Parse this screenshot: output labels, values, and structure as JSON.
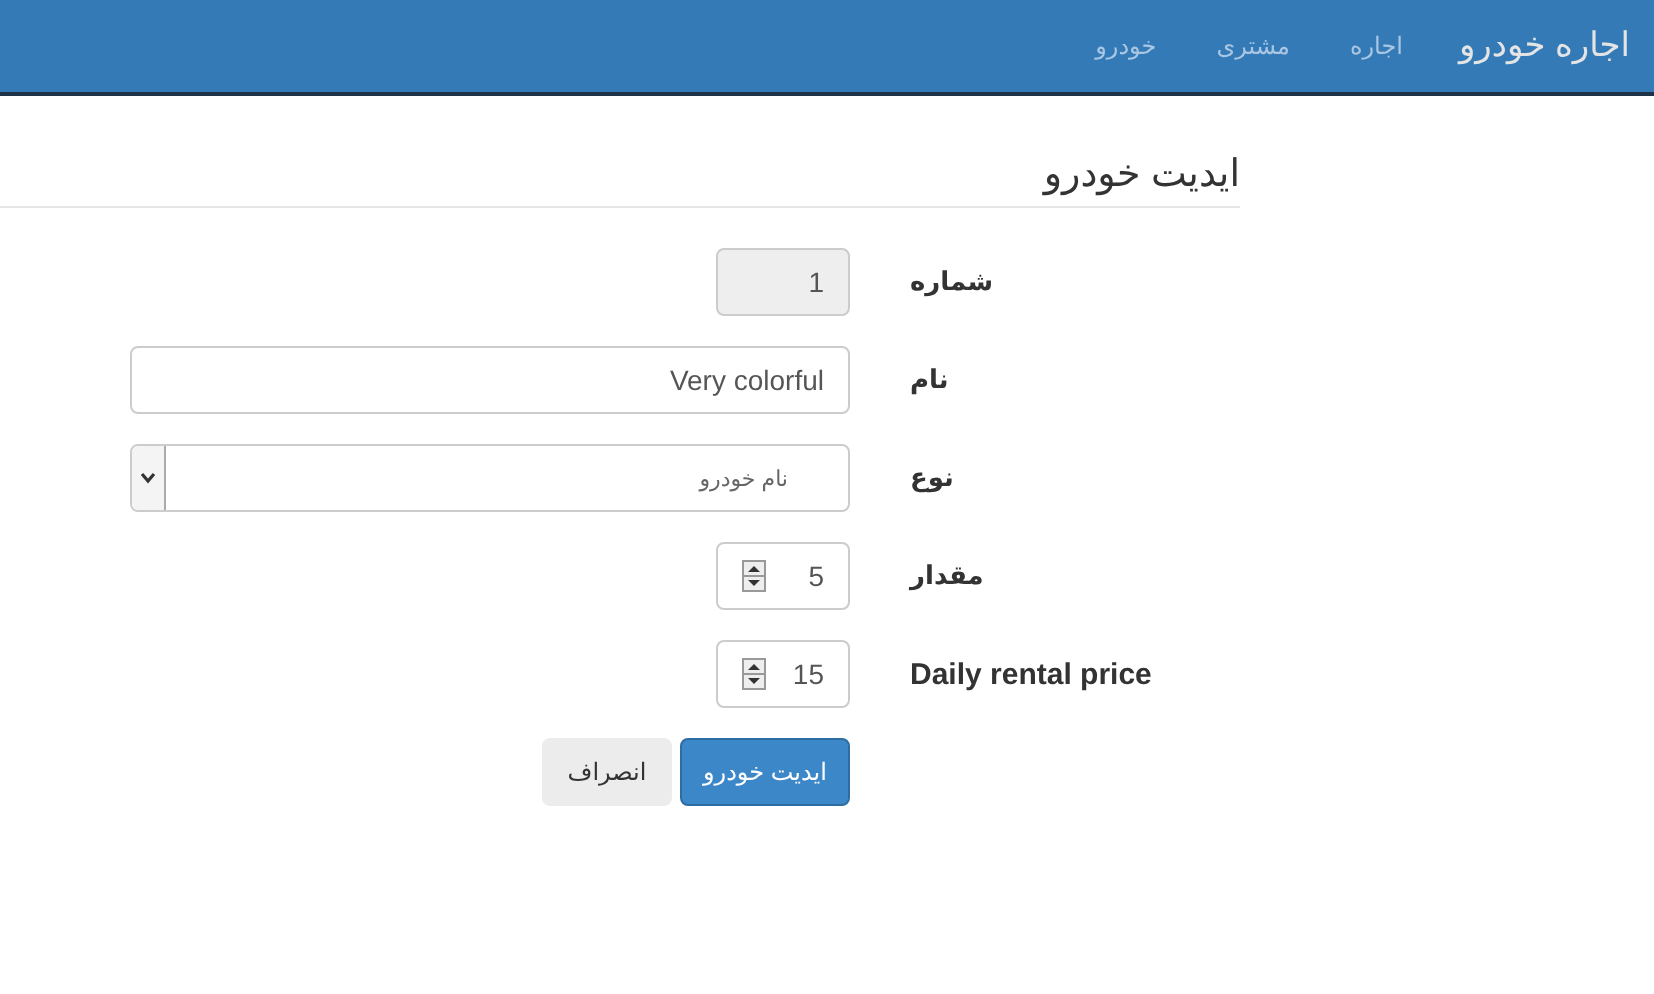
{
  "navbar": {
    "brand": "اجاره خودرو",
    "links": [
      {
        "label": "اجاره"
      },
      {
        "label": "مشتری"
      },
      {
        "label": "خودرو"
      }
    ]
  },
  "page_title": "ایدیت خودرو",
  "form": {
    "fields": [
      {
        "label": "شماره",
        "kind": "text",
        "value": "1",
        "disabled": true
      },
      {
        "label": "نام",
        "kind": "text",
        "value": "Very colorful",
        "disabled": false
      },
      {
        "label": "نوع",
        "kind": "select",
        "value": "نام خودرو"
      },
      {
        "label": "مقدار",
        "kind": "number",
        "value": "5"
      },
      {
        "label": "Daily rental price",
        "kind": "number",
        "value": "15"
      }
    ]
  },
  "buttons": [
    {
      "label": "ایدیت خودرو",
      "kind": "primary"
    },
    {
      "label": "انصراف",
      "kind": "default"
    }
  ]
}
